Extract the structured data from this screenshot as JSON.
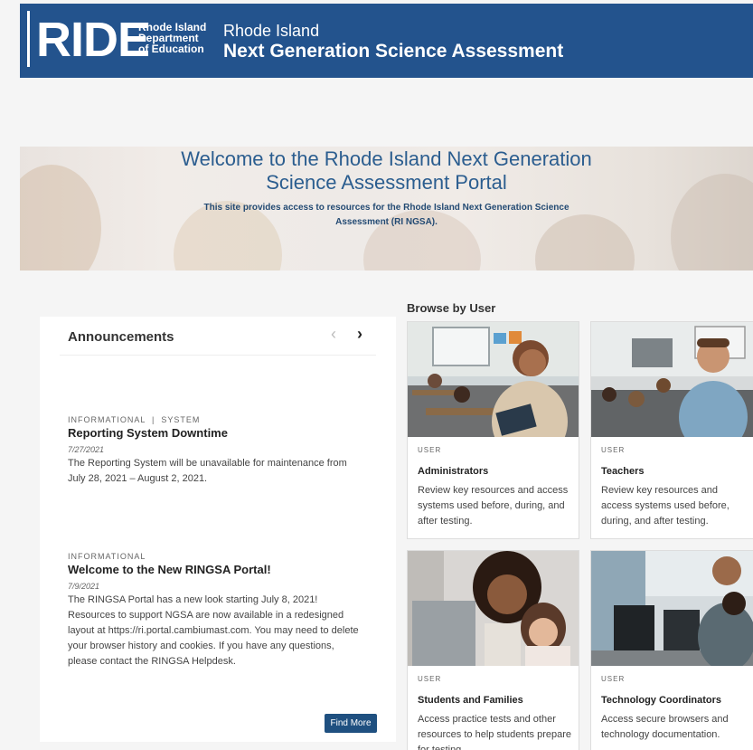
{
  "header": {
    "logo_text": "RIDE",
    "logo_dept_line1": "Rhode Island",
    "logo_dept_line2": "Department",
    "logo_dept_line3": "of Education",
    "subtitle": "Rhode Island",
    "title": "Next Generation Science Assessment"
  },
  "hero": {
    "title_line1": "Welcome to the Rhode Island Next Generation",
    "title_line2": "Science Assessment Portal",
    "desc_line1": "This site provides access to resources for the Rhode Island Next Generation Science",
    "desc_line2": "Assessment (RI NGSA)."
  },
  "announcements": {
    "heading": "Announcements",
    "prev_icon": "‹",
    "next_icon": "›",
    "items": [
      {
        "tag": "INFORMATIONAL  |  SYSTEM",
        "title": "Reporting System Downtime",
        "date": "7/27/2021",
        "body": "The Reporting System will be unavailable for maintenance from July 28, 2021 – August 2, 2021."
      },
      {
        "tag": "INFORMATIONAL",
        "title": "Welcome to the New RINGSA Portal!",
        "date": "7/9/2021",
        "body": "The RINGSA Portal has a new look starting July 8, 2021! Resources to support NGSA are now available in a redesigned layout at https://ri.portal.cambiumast.com. You may need to delete your browser history and cookies. If you have any questions, please contact the RINGSA Helpdesk."
      }
    ],
    "find_more": "Find More"
  },
  "browse": {
    "label": "Browse by User",
    "cards": [
      {
        "caption": "USER",
        "title": "Administrators",
        "desc": "Review key resources and access systems used before, during, and after testing."
      },
      {
        "caption": "USER",
        "title": "Teachers",
        "desc": "Review key resources and access systems used before, during, and after testing."
      },
      {
        "caption": "USER",
        "title": "Students and Families",
        "desc": "Access practice tests and other resources to help students prepare for testing."
      },
      {
        "caption": "USER",
        "title": "Technology Coordinators",
        "desc": "Access secure browsers and technology documentation."
      }
    ]
  },
  "colors": {
    "header_bg": "#23538d",
    "accent": "#1f5080",
    "hero_title": "#2b5d8f"
  }
}
